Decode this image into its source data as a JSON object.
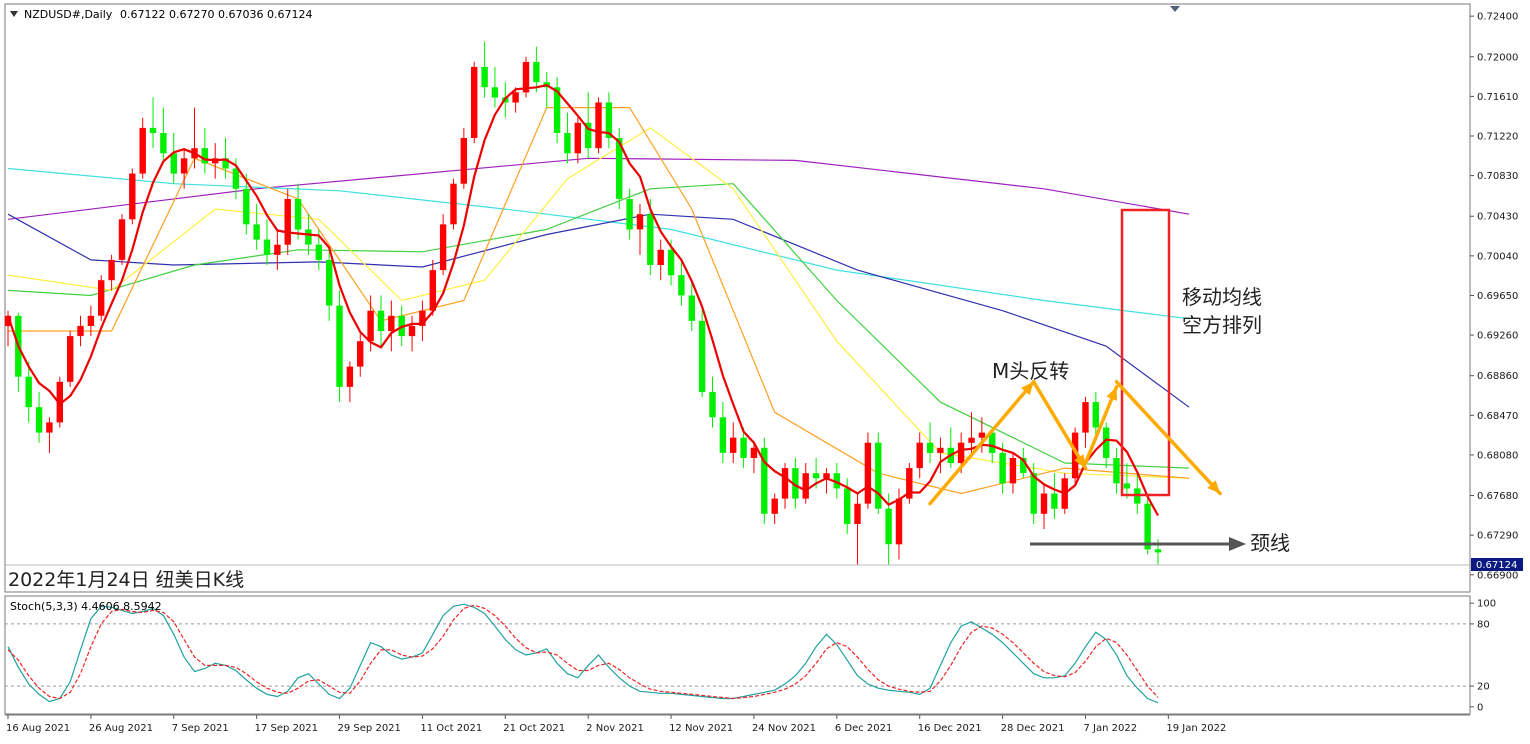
{
  "header": {
    "symbol": "NZDUSD#,Daily",
    "ohlc": "0.67122 0.67270 0.67036 0.67124",
    "stoch_label": "Stoch(5,3,3) 4.4606 8.5942"
  },
  "caption": "2022年1月24日 纽美日K线",
  "annotations": {
    "ma_text_line1": "移动均线",
    "ma_text_line2": "空方排列",
    "m_top": "M头反转",
    "neckline": "颈线"
  },
  "price_tag": "0.67124",
  "colors": {
    "up": "#ff0000",
    "down": "#00ee00",
    "ma5": "#ee0000",
    "ma10": "#ffa020",
    "ma20": "#ffee40",
    "ma40": "#40d040",
    "ma60": "#3030b0",
    "ma120": "#40e0e0",
    "ma200": "#a020c0",
    "arrow": "#ffaa00",
    "box": "#ee2222",
    "stoch_k": "#20a0a0",
    "stoch_d": "#ee2222"
  },
  "chart_data": {
    "type": "candlestick",
    "price_axis": {
      "ylim": [
        0.6675,
        0.725
      ],
      "ticks": [
        "0.72400",
        "0.72000",
        "0.71610",
        "0.71220",
        "0.70830",
        "0.70430",
        "0.70040",
        "0.69650",
        "0.69260",
        "0.68860",
        "0.68470",
        "0.68080",
        "0.67680",
        "0.67290",
        "0.66900"
      ]
    },
    "stoch_axis": {
      "ylim": [
        -5,
        105
      ],
      "ticks": [
        "100",
        "80",
        "20",
        "0"
      ]
    },
    "x_labels": [
      {
        "label": "16 Aug 2021",
        "i": 0
      },
      {
        "label": "26 Aug 2021",
        "i": 8
      },
      {
        "label": "7 Sep 2021",
        "i": 16
      },
      {
        "label": "17 Sep 2021",
        "i": 24
      },
      {
        "label": "29 Sep 2021",
        "i": 32
      },
      {
        "label": "11 Oct 2021",
        "i": 40
      },
      {
        "label": "21 Oct 2021",
        "i": 48
      },
      {
        "label": "2 Nov 2021",
        "i": 56
      },
      {
        "label": "12 Nov 2021",
        "i": 64
      },
      {
        "label": "24 Nov 2021",
        "i": 72
      },
      {
        "label": "6 Dec 2021",
        "i": 80
      },
      {
        "label": "16 Dec 2021",
        "i": 88
      },
      {
        "label": "28 Dec 2021",
        "i": 96
      },
      {
        "label": "7 Jan 2022",
        "i": 104
      },
      {
        "label": "19 Jan 2022",
        "i": 112
      }
    ],
    "candles": [
      [
        0.6935,
        0.695,
        0.6915,
        0.6945
      ],
      [
        0.6945,
        0.6948,
        0.687,
        0.6885
      ],
      [
        0.6885,
        0.69,
        0.684,
        0.6855
      ],
      [
        0.6855,
        0.687,
        0.682,
        0.683
      ],
      [
        0.683,
        0.6845,
        0.681,
        0.684
      ],
      [
        0.684,
        0.6885,
        0.6835,
        0.688
      ],
      [
        0.688,
        0.693,
        0.6875,
        0.6925
      ],
      [
        0.6925,
        0.6945,
        0.6915,
        0.6935
      ],
      [
        0.6935,
        0.6955,
        0.6925,
        0.6945
      ],
      [
        0.6945,
        0.6985,
        0.694,
        0.698
      ],
      [
        0.698,
        0.7005,
        0.697,
        0.7
      ],
      [
        0.7,
        0.7045,
        0.6995,
        0.704
      ],
      [
        0.704,
        0.709,
        0.7035,
        0.7085
      ],
      [
        0.7085,
        0.714,
        0.708,
        0.713
      ],
      [
        0.713,
        0.716,
        0.711,
        0.7125
      ],
      [
        0.7125,
        0.715,
        0.7095,
        0.7105
      ],
      [
        0.7105,
        0.7125,
        0.7075,
        0.7085
      ],
      [
        0.7085,
        0.711,
        0.707,
        0.71
      ],
      [
        0.71,
        0.715,
        0.709,
        0.711
      ],
      [
        0.711,
        0.713,
        0.7085,
        0.7095
      ],
      [
        0.7095,
        0.7115,
        0.708,
        0.71
      ],
      [
        0.71,
        0.712,
        0.708,
        0.709
      ],
      [
        0.709,
        0.71,
        0.706,
        0.707
      ],
      [
        0.707,
        0.7085,
        0.7025,
        0.7035
      ],
      [
        0.7035,
        0.7055,
        0.701,
        0.702
      ],
      [
        0.702,
        0.704,
        0.6995,
        0.7005
      ],
      [
        0.7005,
        0.703,
        0.699,
        0.7015
      ],
      [
        0.7015,
        0.707,
        0.7005,
        0.706
      ],
      [
        0.706,
        0.7075,
        0.702,
        0.703
      ],
      [
        0.703,
        0.7045,
        0.7005,
        0.7015
      ],
      [
        0.7015,
        0.703,
        0.699,
        0.7
      ],
      [
        0.7,
        0.701,
        0.694,
        0.6955
      ],
      [
        0.6955,
        0.697,
        0.686,
        0.6875
      ],
      [
        0.6875,
        0.69,
        0.686,
        0.6895
      ],
      [
        0.6895,
        0.693,
        0.6885,
        0.692
      ],
      [
        0.692,
        0.6965,
        0.691,
        0.695
      ],
      [
        0.695,
        0.6965,
        0.6915,
        0.693
      ],
      [
        0.693,
        0.696,
        0.691,
        0.6945
      ],
      [
        0.6945,
        0.6955,
        0.6915,
        0.6925
      ],
      [
        0.6925,
        0.6945,
        0.691,
        0.6935
      ],
      [
        0.6935,
        0.696,
        0.692,
        0.695
      ],
      [
        0.695,
        0.7,
        0.6945,
        0.699
      ],
      [
        0.699,
        0.7045,
        0.6985,
        0.7035
      ],
      [
        0.7035,
        0.708,
        0.703,
        0.7075
      ],
      [
        0.7075,
        0.713,
        0.707,
        0.712
      ],
      [
        0.712,
        0.7195,
        0.7115,
        0.719
      ],
      [
        0.719,
        0.7215,
        0.716,
        0.717
      ],
      [
        0.717,
        0.719,
        0.715,
        0.716
      ],
      [
        0.716,
        0.7175,
        0.714,
        0.7155
      ],
      [
        0.7155,
        0.717,
        0.7145,
        0.7165
      ],
      [
        0.7165,
        0.72,
        0.716,
        0.7195
      ],
      [
        0.7195,
        0.721,
        0.7165,
        0.7175
      ],
      [
        0.7175,
        0.7185,
        0.715,
        0.717
      ],
      [
        0.717,
        0.718,
        0.7115,
        0.7125
      ],
      [
        0.7125,
        0.7145,
        0.7095,
        0.7105
      ],
      [
        0.7105,
        0.714,
        0.7095,
        0.7135
      ],
      [
        0.7135,
        0.7165,
        0.71,
        0.711
      ],
      [
        0.711,
        0.716,
        0.7105,
        0.7155
      ],
      [
        0.7155,
        0.7165,
        0.711,
        0.712
      ],
      [
        0.712,
        0.713,
        0.705,
        0.706
      ],
      [
        0.706,
        0.707,
        0.702,
        0.703
      ],
      [
        0.703,
        0.7055,
        0.7005,
        0.7045
      ],
      [
        0.7045,
        0.706,
        0.6985,
        0.6995
      ],
      [
        0.6995,
        0.702,
        0.698,
        0.701
      ],
      [
        0.701,
        0.702,
        0.6975,
        0.6985
      ],
      [
        0.6985,
        0.7,
        0.6955,
        0.6965
      ],
      [
        0.6965,
        0.698,
        0.693,
        0.694
      ],
      [
        0.694,
        0.6955,
        0.6865,
        0.687
      ],
      [
        0.687,
        0.6885,
        0.6835,
        0.6845
      ],
      [
        0.6845,
        0.686,
        0.68,
        0.681
      ],
      [
        0.681,
        0.684,
        0.68,
        0.6825
      ],
      [
        0.6825,
        0.6835,
        0.6795,
        0.6805
      ],
      [
        0.6805,
        0.682,
        0.679,
        0.6815
      ],
      [
        0.6815,
        0.6825,
        0.674,
        0.675
      ],
      [
        0.675,
        0.677,
        0.674,
        0.6765
      ],
      [
        0.6765,
        0.68,
        0.6755,
        0.6795
      ],
      [
        0.6795,
        0.6805,
        0.6755,
        0.6765
      ],
      [
        0.6765,
        0.68,
        0.676,
        0.679
      ],
      [
        0.679,
        0.6805,
        0.6775,
        0.6785
      ],
      [
        0.6785,
        0.6795,
        0.677,
        0.679
      ],
      [
        0.679,
        0.68,
        0.6765,
        0.6775
      ],
      [
        0.6775,
        0.6785,
        0.673,
        0.674
      ],
      [
        0.674,
        0.677,
        0.67,
        0.676
      ],
      [
        0.676,
        0.683,
        0.6755,
        0.682
      ],
      [
        0.682,
        0.683,
        0.675,
        0.6755
      ],
      [
        0.6755,
        0.677,
        0.67,
        0.672
      ],
      [
        0.672,
        0.6775,
        0.6705,
        0.6765
      ],
      [
        0.6765,
        0.68,
        0.676,
        0.6795
      ],
      [
        0.6795,
        0.683,
        0.6785,
        0.682
      ],
      [
        0.682,
        0.684,
        0.68,
        0.681
      ],
      [
        0.681,
        0.6825,
        0.679,
        0.6815
      ],
      [
        0.6815,
        0.6835,
        0.6795,
        0.68
      ],
      [
        0.68,
        0.683,
        0.679,
        0.682
      ],
      [
        0.682,
        0.685,
        0.681,
        0.6825
      ],
      [
        0.6825,
        0.6845,
        0.681,
        0.683
      ],
      [
        0.683,
        0.6835,
        0.68,
        0.681
      ],
      [
        0.681,
        0.682,
        0.677,
        0.678
      ],
      [
        0.678,
        0.681,
        0.677,
        0.6805
      ],
      [
        0.6805,
        0.6815,
        0.6785,
        0.679
      ],
      [
        0.679,
        0.68,
        0.674,
        0.675
      ],
      [
        0.675,
        0.678,
        0.6735,
        0.677
      ],
      [
        0.677,
        0.679,
        0.6745,
        0.6755
      ],
      [
        0.6755,
        0.679,
        0.675,
        0.6785
      ],
      [
        0.6785,
        0.6835,
        0.678,
        0.683
      ],
      [
        0.683,
        0.6865,
        0.6815,
        0.686
      ],
      [
        0.686,
        0.687,
        0.6825,
        0.6835
      ],
      [
        0.6835,
        0.684,
        0.6795,
        0.6805
      ],
      [
        0.6805,
        0.6815,
        0.677,
        0.678
      ],
      [
        0.678,
        0.68,
        0.6765,
        0.6775
      ],
      [
        0.6775,
        0.679,
        0.675,
        0.676
      ],
      [
        0.676,
        0.677,
        0.671,
        0.6715
      ],
      [
        0.6715,
        0.6725,
        0.67,
        0.6712
      ]
    ],
    "moving_averages": [
      {
        "key": "ma200",
        "points": [
          [
            0,
            0.704
          ],
          [
            24,
            0.707
          ],
          [
            56,
            0.71
          ],
          [
            76,
            0.7098
          ],
          [
            100,
            0.707
          ],
          [
            114,
            0.7045
          ]
        ]
      },
      {
        "key": "ma120",
        "points": [
          [
            0,
            0.709
          ],
          [
            16,
            0.7075
          ],
          [
            32,
            0.7068
          ],
          [
            48,
            0.705
          ],
          [
            64,
            0.703
          ],
          [
            80,
            0.699
          ],
          [
            100,
            0.696
          ],
          [
            114,
            0.6942
          ]
        ]
      },
      {
        "key": "ma60",
        "points": [
          [
            0,
            0.7045
          ],
          [
            8,
            0.7
          ],
          [
            16,
            0.6995
          ],
          [
            30,
            0.6998
          ],
          [
            40,
            0.6993
          ],
          [
            52,
            0.7025
          ],
          [
            62,
            0.7045
          ],
          [
            70,
            0.704
          ],
          [
            82,
            0.699
          ],
          [
            96,
            0.695
          ],
          [
            106,
            0.6915
          ],
          [
            114,
            0.6855
          ]
        ]
      },
      {
        "key": "ma40",
        "points": [
          [
            0,
            0.697
          ],
          [
            8,
            0.6965
          ],
          [
            18,
            0.6995
          ],
          [
            28,
            0.701
          ],
          [
            40,
            0.7008
          ],
          [
            52,
            0.703
          ],
          [
            62,
            0.707
          ],
          [
            70,
            0.7075
          ],
          [
            80,
            0.696
          ],
          [
            90,
            0.686
          ],
          [
            102,
            0.68
          ],
          [
            114,
            0.6795
          ]
        ]
      },
      {
        "key": "ma20",
        "points": [
          [
            0,
            0.6985
          ],
          [
            10,
            0.697
          ],
          [
            20,
            0.705
          ],
          [
            30,
            0.704
          ],
          [
            38,
            0.696
          ],
          [
            46,
            0.698
          ],
          [
            54,
            0.708
          ],
          [
            62,
            0.713
          ],
          [
            70,
            0.707
          ],
          [
            80,
            0.692
          ],
          [
            90,
            0.681
          ],
          [
            102,
            0.679
          ],
          [
            114,
            0.6785
          ]
        ]
      },
      {
        "key": "ma10",
        "points": [
          [
            0,
            0.693
          ],
          [
            10,
            0.693
          ],
          [
            18,
            0.71
          ],
          [
            28,
            0.706
          ],
          [
            36,
            0.694
          ],
          [
            44,
            0.696
          ],
          [
            52,
            0.715
          ],
          [
            60,
            0.715
          ],
          [
            66,
            0.705
          ],
          [
            74,
            0.685
          ],
          [
            84,
            0.679
          ],
          [
            92,
            0.677
          ],
          [
            102,
            0.6795
          ],
          [
            114,
            0.6785
          ]
        ]
      }
    ],
    "stochastic": {
      "k": [
        58,
        38,
        22,
        12,
        5,
        8,
        24,
        55,
        85,
        97,
        96,
        93,
        90,
        92,
        95,
        88,
        70,
        48,
        34,
        37,
        42,
        40,
        35,
        26,
        18,
        12,
        10,
        15,
        28,
        32,
        22,
        12,
        8,
        18,
        40,
        62,
        58,
        50,
        46,
        48,
        52,
        70,
        88,
        97,
        99,
        96,
        90,
        78,
        65,
        55,
        50,
        52,
        56,
        42,
        32,
        28,
        40,
        50,
        38,
        28,
        20,
        15,
        14,
        13,
        13,
        12,
        11,
        10,
        9,
        8,
        8,
        10,
        12,
        14,
        16,
        22,
        30,
        42,
        58,
        70,
        60,
        45,
        30,
        22,
        18,
        16,
        15,
        14,
        12,
        18,
        40,
        62,
        78,
        82,
        76,
        70,
        62,
        52,
        42,
        32,
        28,
        28,
        30,
        42,
        58,
        72,
        65,
        50,
        30,
        18,
        8,
        4
      ],
      "d": [
        55,
        45,
        30,
        18,
        10,
        8,
        14,
        32,
        58,
        80,
        92,
        94,
        92,
        91,
        93,
        91,
        82,
        65,
        48,
        40,
        40,
        40,
        38,
        32,
        24,
        18,
        14,
        13,
        18,
        25,
        26,
        20,
        14,
        13,
        25,
        42,
        55,
        55,
        50,
        48,
        49,
        56,
        68,
        84,
        95,
        98,
        95,
        88,
        78,
        66,
        57,
        52,
        53,
        50,
        42,
        35,
        35,
        40,
        42,
        36,
        28,
        22,
        17,
        15,
        14,
        13,
        12,
        11,
        10,
        9,
        8,
        9,
        10,
        12,
        14,
        17,
        22,
        30,
        42,
        56,
        62,
        58,
        48,
        36,
        26,
        20,
        17,
        15,
        14,
        15,
        25,
        40,
        58,
        72,
        78,
        76,
        70,
        62,
        52,
        42,
        34,
        30,
        29,
        33,
        44,
        58,
        66,
        62,
        50,
        35,
        20,
        9
      ]
    }
  }
}
